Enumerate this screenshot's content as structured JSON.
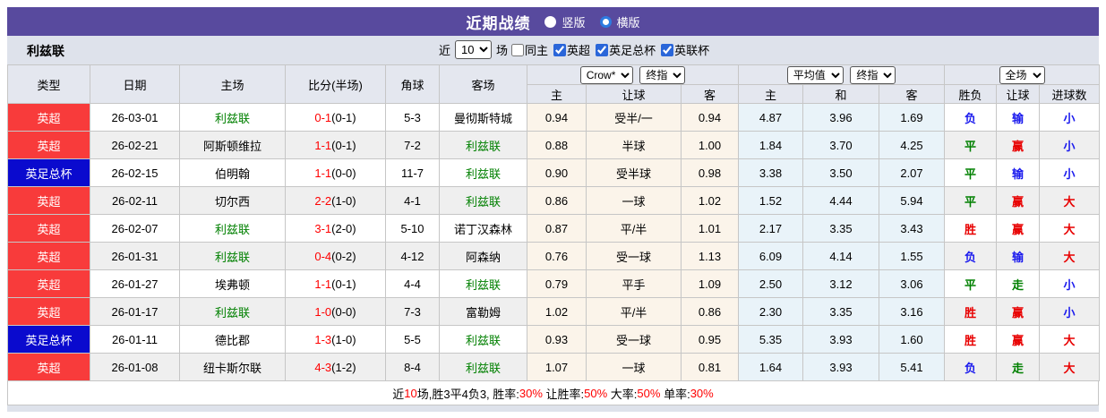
{
  "title_bar": {
    "title": "近期战绩",
    "radios": [
      {
        "label": "竖版",
        "checked": false
      },
      {
        "label": "横版",
        "checked": true
      }
    ]
  },
  "control_bar": {
    "team": "利兹联",
    "near_label": "近",
    "count_value": "10",
    "matches_label": "场",
    "checkboxes": [
      {
        "label": "同主",
        "checked": false
      },
      {
        "label": "英超",
        "checked": true
      },
      {
        "label": "英足总杯",
        "checked": true
      },
      {
        "label": "英联杯",
        "checked": true
      }
    ]
  },
  "table": {
    "static_headers": [
      "类型",
      "日期",
      "主场",
      "比分(半场)",
      "角球",
      "客场"
    ],
    "group_crow": {
      "select1": "Crow*",
      "select2": "终指",
      "sub": [
        "主",
        "让球",
        "客"
      ]
    },
    "group_avg": {
      "select1": "平均值",
      "select2": "终指",
      "sub": [
        "主",
        "和",
        "客"
      ]
    },
    "group_result": {
      "select1": "全场",
      "sub": [
        "胜负",
        "让球",
        "进球数"
      ]
    },
    "rows": [
      {
        "type": "英超",
        "date": "26-03-01",
        "home": "利兹联",
        "home_is_team": true,
        "score": "0-1",
        "half": "(0-1)",
        "corner": "5-3",
        "away": "曼彻斯特城",
        "away_is_team": false,
        "crow": [
          "0.94",
          "受半/一",
          "0.94"
        ],
        "avg": [
          "4.87",
          "3.96",
          "1.69"
        ],
        "result": [
          "负",
          "输",
          "小"
        ]
      },
      {
        "type": "英超",
        "date": "26-02-21",
        "home": "阿斯顿维拉",
        "home_is_team": false,
        "score": "1-1",
        "half": "(0-1)",
        "corner": "7-2",
        "away": "利兹联",
        "away_is_team": true,
        "crow": [
          "0.88",
          "半球",
          "1.00"
        ],
        "avg": [
          "1.84",
          "3.70",
          "4.25"
        ],
        "result": [
          "平",
          "赢",
          "小"
        ]
      },
      {
        "type": "英足总杯",
        "date": "26-02-15",
        "home": "伯明翰",
        "home_is_team": false,
        "score": "1-1",
        "half": "(0-0)",
        "corner": "11-7",
        "away": "利兹联",
        "away_is_team": true,
        "crow": [
          "0.90",
          "受半球",
          "0.98"
        ],
        "avg": [
          "3.38",
          "3.50",
          "2.07"
        ],
        "result": [
          "平",
          "输",
          "小"
        ]
      },
      {
        "type": "英超",
        "date": "26-02-11",
        "home": "切尔西",
        "home_is_team": false,
        "score": "2-2",
        "half": "(1-0)",
        "corner": "4-1",
        "away": "利兹联",
        "away_is_team": true,
        "crow": [
          "0.86",
          "一球",
          "1.02"
        ],
        "avg": [
          "1.52",
          "4.44",
          "5.94"
        ],
        "result": [
          "平",
          "赢",
          "大"
        ]
      },
      {
        "type": "英超",
        "date": "26-02-07",
        "home": "利兹联",
        "home_is_team": true,
        "score": "3-1",
        "half": "(2-0)",
        "corner": "5-10",
        "away": "诺丁汉森林",
        "away_is_team": false,
        "crow": [
          "0.87",
          "平/半",
          "1.01"
        ],
        "avg": [
          "2.17",
          "3.35",
          "3.43"
        ],
        "result": [
          "胜",
          "赢",
          "大"
        ]
      },
      {
        "type": "英超",
        "date": "26-01-31",
        "home": "利兹联",
        "home_is_team": true,
        "score": "0-4",
        "half": "(0-2)",
        "corner": "4-12",
        "away": "阿森纳",
        "away_is_team": false,
        "crow": [
          "0.76",
          "受一球",
          "1.13"
        ],
        "avg": [
          "6.09",
          "4.14",
          "1.55"
        ],
        "result": [
          "负",
          "输",
          "大"
        ]
      },
      {
        "type": "英超",
        "date": "26-01-27",
        "home": "埃弗顿",
        "home_is_team": false,
        "score": "1-1",
        "half": "(0-1)",
        "corner": "4-4",
        "away": "利兹联",
        "away_is_team": true,
        "crow": [
          "0.79",
          "平手",
          "1.09"
        ],
        "avg": [
          "2.50",
          "3.12",
          "3.06"
        ],
        "result": [
          "平",
          "走",
          "小"
        ]
      },
      {
        "type": "英超",
        "date": "26-01-17",
        "home": "利兹联",
        "home_is_team": true,
        "score": "1-0",
        "half": "(0-0)",
        "corner": "7-3",
        "away": "富勒姆",
        "away_is_team": false,
        "crow": [
          "1.02",
          "平/半",
          "0.86"
        ],
        "avg": [
          "2.30",
          "3.35",
          "3.16"
        ],
        "result": [
          "胜",
          "赢",
          "小"
        ]
      },
      {
        "type": "英足总杯",
        "date": "26-01-11",
        "home": "德比郡",
        "home_is_team": false,
        "score": "1-3",
        "half": "(1-0)",
        "corner": "5-5",
        "away": "利兹联",
        "away_is_team": true,
        "crow": [
          "0.93",
          "受一球",
          "0.95"
        ],
        "avg": [
          "5.35",
          "3.93",
          "1.60"
        ],
        "result": [
          "胜",
          "赢",
          "大"
        ]
      },
      {
        "type": "英超",
        "date": "26-01-08",
        "home": "纽卡斯尔联",
        "home_is_team": false,
        "score": "4-3",
        "half": "(1-2)",
        "corner": "8-4",
        "away": "利兹联",
        "away_is_team": true,
        "crow": [
          "1.07",
          "一球",
          "0.81"
        ],
        "avg": [
          "1.64",
          "3.93",
          "5.41"
        ],
        "result": [
          "负",
          "走",
          "大"
        ]
      }
    ]
  },
  "footer": {
    "segments": [
      {
        "text": "近",
        "red": false
      },
      {
        "text": "10",
        "red": true
      },
      {
        "text": "场,胜3平4负3, 胜率:",
        "red": false
      },
      {
        "text": "30%",
        "red": true
      },
      {
        "text": " 让胜率:",
        "red": false
      },
      {
        "text": "50%",
        "red": true
      },
      {
        "text": " 大率:",
        "red": false
      },
      {
        "text": "50%",
        "red": true
      },
      {
        "text": " 单率:",
        "red": false
      },
      {
        "text": "30%",
        "red": true
      }
    ]
  },
  "colors": {
    "accent_purple": "#584a9e",
    "league": {
      "英超": "#f83b3b",
      "英足总杯": "#0a0ace"
    },
    "team_green": "#008000",
    "score_red": "#ff0000",
    "footer_red": "#ff0000",
    "result": {
      "胜": "#e80000",
      "负": "#1a1aee",
      "平": "#008000",
      "赢": "#e80000",
      "输": "#1a1aee",
      "走": "#008000",
      "大": "#e80000",
      "小": "#1a1aee"
    }
  }
}
